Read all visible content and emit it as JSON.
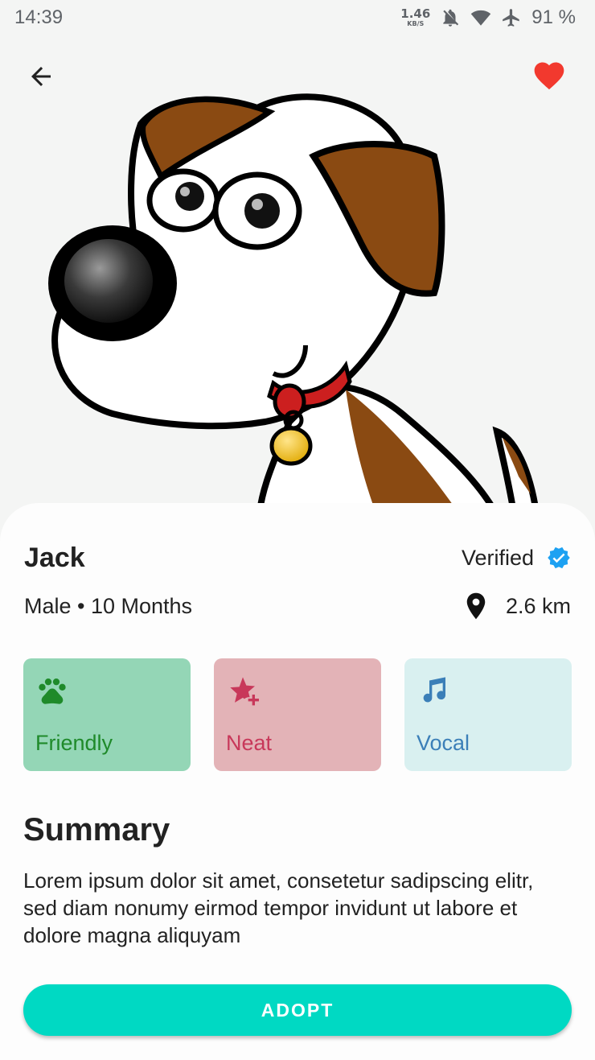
{
  "status_bar": {
    "time": "14:39",
    "net_speed_value": "1.46",
    "net_speed_unit": "KB/S",
    "battery": "91 %",
    "icons": [
      "bell-off-icon",
      "wifi-icon",
      "airplane-icon"
    ]
  },
  "header": {
    "back_icon": "arrow-left-icon",
    "favorite_icon": "heart-icon",
    "favorite_color": "#f2392e"
  },
  "pet": {
    "name": "Jack",
    "verified_label": "Verified",
    "verified_color": "#1da1f2",
    "sex_age": "Male • 10 Months",
    "distance": "2.6 km"
  },
  "traits": [
    {
      "label": "Friendly",
      "icon": "paw-icon",
      "bg": "#94d6b6",
      "fg": "#1f8a2a"
    },
    {
      "label": "Neat",
      "icon": "star-plus-icon",
      "bg": "#e3b3b7",
      "fg": "#c8385a"
    },
    {
      "label": "Vocal",
      "icon": "music-note-icon",
      "bg": "#d9f0f0",
      "fg": "#3b7fb8"
    }
  ],
  "summary": {
    "title": "Summary",
    "text": "Lorem ipsum dolor sit amet, consetetur sadipscing elitr, sed diam nonumy eirmod tempor invidunt ut labore et dolore magna aliquyam"
  },
  "adopt_button": {
    "label": "ADOPT",
    "color": "#00d9c3"
  }
}
